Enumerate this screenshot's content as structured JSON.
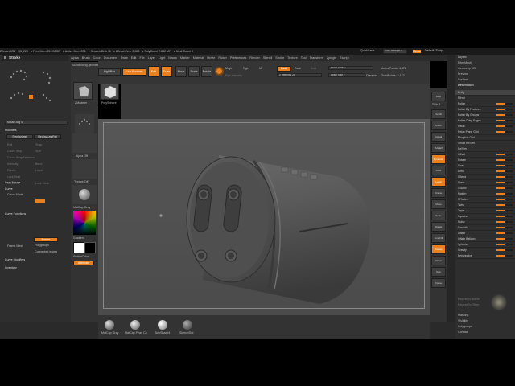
{
  "topbar": {
    "items": [
      "ZBrush 4R8",
      "Q5_229",
      "● Free Mem 25.998GB",
      "● Active Mem 876",
      "● Scratch Disk 48",
      "● ZBrushTime 0.085",
      "● PolyCount 2.852 MP",
      "● MeshCount 0"
    ],
    "quicksave": "QuickSave",
    "seethrough": "See-through 0",
    "menus_btn": "Menus",
    "script": "DefaultZScript"
  },
  "menubar": [
    "Alpha",
    "Brush",
    "Color",
    "Document",
    "Draw",
    "Edit",
    "File",
    "Layer",
    "Light",
    "Macro",
    "Marker",
    "Material",
    "Movie",
    "Picker",
    "Preferences",
    "Render",
    "Stencil",
    "Stroke",
    "Texture",
    "Tool",
    "Transform",
    "Zplugin",
    "Zscript"
  ],
  "status_note": "Subdividing geometry and DFIts 1.14 million quad polygons...",
  "left": {
    "title": "Stroke",
    "mouse_avg": "Mouse Avg 4",
    "modifiers": "Modifiers",
    "replay_last": "ReplayLast",
    "replay_last_rel": "ReplayLastRel",
    "lazy_mouse": "Lazy Mouse",
    "curve": "Curve",
    "curve_mode": "Curve Mode",
    "curve_functions": "Curve Functions",
    "border": "Border",
    "polygroups": "Polygroups",
    "frame_mesh": "Frame Mesh",
    "connected_edges": "Connected edges",
    "curve_modifiers": "Curve Modifiers",
    "inventory": "Inventory",
    "faded_items": [
      "Roll",
      "Curve Step",
      "Curve Snap Distance",
      "Snap",
      "Size",
      "Intensity",
      "Bend",
      "Elastic",
      "Liquid",
      "Lock Start",
      "Lock End",
      "Lock Mesh"
    ]
  },
  "tools_left": {
    "tools": [
      "ZModeler",
      "PolySphere"
    ],
    "alpha": "Alpha Off",
    "texture": "Texture Off",
    "material": "MatCap Gray",
    "gradient": "Gradient",
    "switch_color": "SwitchColor",
    "alternate": "Alternate"
  },
  "toolbar": {
    "lightbox": "LightBox",
    "live_boolean": "Live Boolean",
    "edit": "Edit",
    "draw": "Draw",
    "move": "Move",
    "scale": "Scale",
    "rotate": "Rotate",
    "mrgb": "Mrgb",
    "rgb": "Rgb",
    "m": "M",
    "rgb_intensity": "Rgb Intensity",
    "zadd": "Zadd",
    "zsub": "Zsub",
    "zcut": "Zcut",
    "z_intensity": "Z Intensity 25",
    "focal_shift": "Focal Shift 0",
    "draw_size": "Draw Size 7",
    "dynamic": "Dynamic",
    "active_points": "ActivePoints: 4,472",
    "total_points": "TotalPoints: 5,172"
  },
  "right_tools": [
    "BPR",
    "SPix 3",
    "Scroll",
    "Zoom",
    "Actual",
    "AAHalf",
    "Dynamic Persp",
    "Floor",
    "Local",
    "Frame",
    "Move",
    "Scale",
    "Rotate",
    "Line Fill PolyF",
    "Transp",
    "Ghost",
    "Solo",
    "Xpose"
  ],
  "right": {
    "top_items": [
      "Layers",
      "FiberMesh",
      "Geometry HD",
      "Preview",
      "Surface",
      "Deformation"
    ],
    "subpalette_items": [
      "Unify",
      "Mirror",
      "Polish",
      "Polish By Features",
      "Polish By Groups",
      "Polish Crisp Edges",
      "Relax",
      "Relax Plane Grid",
      "Morph to Grid",
      "Smart ReSym",
      "ReSym",
      "Offset",
      "Rotate",
      "Size",
      "Bend",
      "SBend",
      "Skew",
      "SSkew",
      "Flatten",
      "SFlatten",
      "Twist",
      "Taper",
      "Squeeze",
      "Noise",
      "Smooth",
      "Inflate",
      "Inflate Balloon",
      "Spherize",
      "Gravity",
      "Perspective"
    ],
    "faded_items": [
      "Repeat To Active",
      "Repeat To Other"
    ],
    "bottom_items": [
      "Masking",
      "Visibility",
      "Polygroups",
      "Contact"
    ]
  },
  "bottom_shelf": [
    "MatCap Gray",
    "MatCap Pearl Ca",
    "SkinShade4",
    "SketchShd"
  ],
  "colors": {
    "accent": "#e8801f",
    "panel": "#2e2e2e",
    "viewport": "#555555"
  }
}
